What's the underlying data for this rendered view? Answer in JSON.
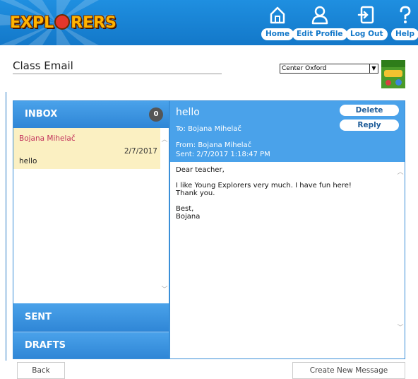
{
  "header": {
    "logo_text_1": "EXPL",
    "logo_text_2": "RERS",
    "nav": [
      {
        "label": "Home",
        "icon": "home-icon"
      },
      {
        "label": "Edit Profile",
        "icon": "user-icon"
      },
      {
        "label": "Log Out",
        "icon": "logout-icon"
      },
      {
        "label": "Help",
        "icon": "help-icon"
      }
    ]
  },
  "page": {
    "title": "Class Email",
    "center_select": "Center Oxford"
  },
  "folders": {
    "inbox": {
      "label": "INBOX",
      "count": "0"
    },
    "sent": {
      "label": "SENT"
    },
    "drafts": {
      "label": "DRAFTS"
    }
  },
  "messages": [
    {
      "from": "Bojana Mihelač",
      "date": "2/7/2017",
      "subject": "hello"
    }
  ],
  "open_message": {
    "subject": "hello",
    "to": "To: Bojana Mihelač",
    "from": "From: Bojana Mihelač",
    "sent": "Sent: 2/7/2017 1:18:47 PM",
    "delete_label": "Delete",
    "reply_label": "Reply",
    "body": {
      "greeting": "Dear teacher,",
      "line1": "I like Young Explorers very much. I have fun here!",
      "line2": "Thank you.",
      "closing": "Best,",
      "name": "Bojana"
    }
  },
  "footer": {
    "back_label": "Back",
    "new_message_label": "Create New Message"
  },
  "colors": {
    "header_blue": "#1378c9",
    "panel_blue": "#4aa2ea",
    "selected_row": "#fbf0c2",
    "sender_pink": "#c2305a"
  }
}
